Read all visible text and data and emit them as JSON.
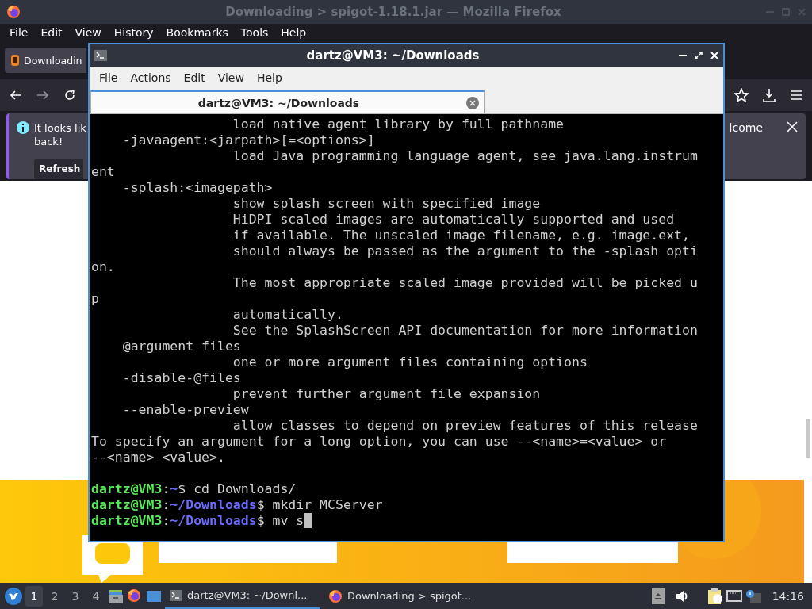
{
  "browser": {
    "title": "Downloading > spigot-1.18.1.jar — Mozilla Firefox",
    "menu": [
      "File",
      "Edit",
      "View",
      "History",
      "Bookmarks",
      "Tools",
      "Help"
    ],
    "tabs": [
      {
        "label": "Downloadin",
        "selected": true
      }
    ],
    "notification": {
      "text_start": "It looks lik",
      "text_start_line2": "back!",
      "text_end": "lcome",
      "button": "Refresh"
    }
  },
  "terminal": {
    "title": "dartz@VM3: ~/Downloads",
    "menu": [
      "File",
      "Actions",
      "Edit",
      "View",
      "Help"
    ],
    "tabs": [
      {
        "label": "dartz@VM3: ~/Downloads",
        "selected": true
      }
    ],
    "output": [
      "                  load native agent library by full pathname",
      "    -javaagent:<jarpath>[=<options>]",
      "                  load Java programming language agent, see java.lang.instrum",
      "ent",
      "    -splash:<imagepath>",
      "                  show splash screen with specified image",
      "                  HiDPI scaled images are automatically supported and used",
      "                  if available. The unscaled image filename, e.g. image.ext,",
      "                  should always be passed as the argument to the -splash opti",
      "on.",
      "                  The most appropriate scaled image provided will be picked u",
      "p",
      "                  automatically.",
      "                  See the SplashScreen API documentation for more information",
      "    @argument files",
      "                  one or more argument files containing options",
      "    -disable-@files",
      "                  prevent further argument file expansion",
      "    --enable-preview",
      "                  allow classes to depend on preview features of this release",
      "To specify an argument for a long option, you can use --<name>=<value> or",
      "--<name> <value>."
    ],
    "prompts": [
      {
        "user": "dartz@VM3",
        "separator": ":",
        "path": "~",
        "symbol": "$",
        "command": " cd Downloads/",
        "cursor": false
      },
      {
        "user": "dartz@VM3",
        "separator": ":",
        "path": "~/Downloads",
        "symbol": "$",
        "command": " mkdir MCServer",
        "cursor": false
      },
      {
        "user": "dartz@VM3",
        "separator": ":",
        "path": "~/Downloads",
        "symbol": "$",
        "command": " mv s",
        "cursor": true
      }
    ]
  },
  "taskbar": {
    "workspaces": [
      {
        "label": "1",
        "selected": true
      },
      {
        "label": "2",
        "selected": false
      },
      {
        "label": "3",
        "selected": false
      },
      {
        "label": "4",
        "selected": false
      }
    ],
    "tasks": [
      {
        "kind": "terminal",
        "label": "dartz@VM3: ~/Downl...",
        "selected": true
      },
      {
        "kind": "firefox",
        "label": "Downloading > spigot...",
        "selected": false
      }
    ],
    "clock": "14:16"
  }
}
